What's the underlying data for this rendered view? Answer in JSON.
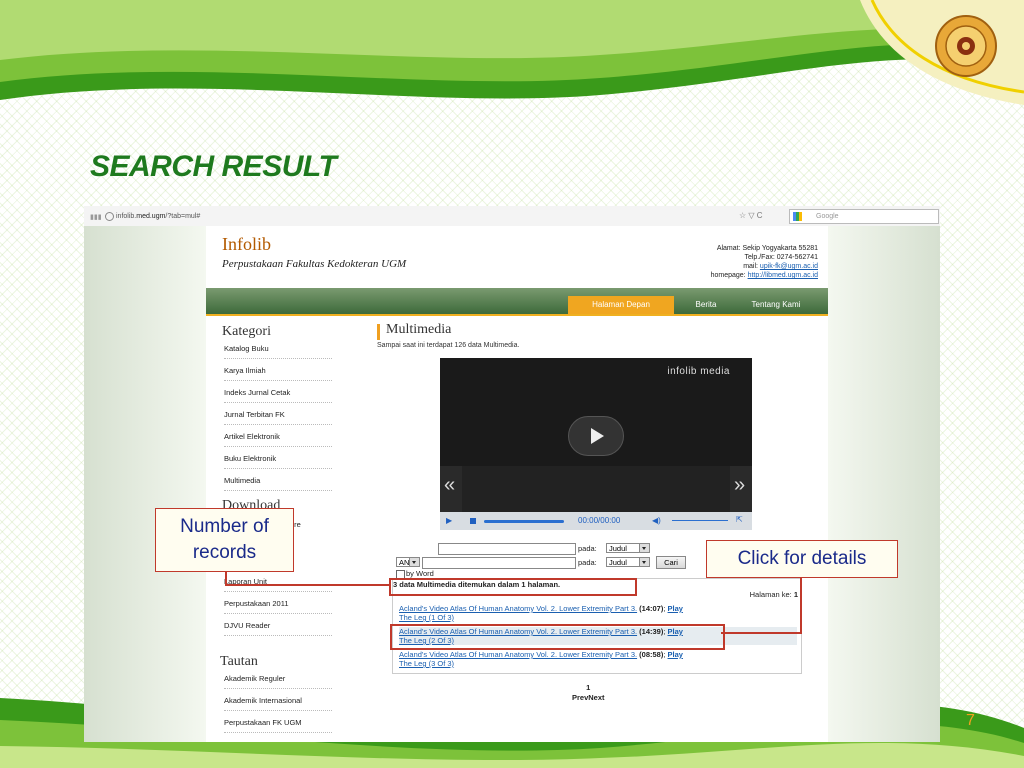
{
  "slide": {
    "title": "SEARCH RESULT",
    "page_number": "7",
    "colors": {
      "accent_green": "#1e7a1e",
      "page_number": "#f0a020",
      "callout_red": "#c0392b",
      "callout_text": "#1a2a8a"
    }
  },
  "browser": {
    "url_prefix": "infolib.",
    "url_domain": "med.ugm",
    "url_suffix": "/?tab=mul#",
    "controls": "☆ ▽ C",
    "search_placeholder": "Google"
  },
  "site": {
    "title": "Infolib",
    "subtitle": "Perpustakaan Fakultas Kedokteran UGM",
    "address": "Alamat: Sekip Yogyakarta 55281",
    "phone": "Telp./Fax: 0274-562741",
    "mail_label": "mail: ",
    "mail": "upik-fk@ugm.ac.id",
    "homepage_label": "homepage: ",
    "homepage": "http://libmed.ugm.ac.id",
    "nav": [
      "Halaman Depan",
      "Berita",
      "Tentang Kami"
    ]
  },
  "sidebar": {
    "kategori_title": "Kategori",
    "kategori": [
      "Katalog Buku",
      "Karya Ilmiah",
      "Indeks Jurnal Cetak",
      "Jurnal Terbitan FK",
      "Artikel Elektronik",
      "Buku Elektronik",
      "Multimedia"
    ],
    "download_title": "Download",
    "download_partial": "ure",
    "download": [
      "Laporan Unit",
      "Perpustakaan 2011",
      "DJVU Reader"
    ],
    "tautan_title": "Tautan",
    "tautan": [
      "Akademik Reguler",
      "Akademik Internasional",
      "Perpustakaan FK UGM"
    ]
  },
  "main": {
    "section_title": "Multimedia",
    "section_sub": "Sampai saat ini terdapat 126 data Multimedia.",
    "player": {
      "brand": "infolib media",
      "time": "00:00/00:00",
      "prev": "«",
      "next": "»"
    },
    "search": {
      "pada": "pada:",
      "field1": "Judul",
      "field2": "Judul",
      "operator": "AND",
      "button": "Cari",
      "by_word": "by Word"
    },
    "result_count": "3 data Multimedia ditemukan dalam 1 halaman.",
    "halaman_label": "Halaman ke: ",
    "halaman_value": "1",
    "results": [
      {
        "title": "Acland's Video Atlas Of Human Anatomy Vol. 2. Lower Extremity Part 3.",
        "duration": "(14:07)",
        "play": "Play",
        "sub": "The Leg (1 Of 3)"
      },
      {
        "title": "Acland's Video Atlas Of Human Anatomy Vol. 2. Lower Extremity Part 3.",
        "duration": "(14:39)",
        "play": "Play",
        "sub": "The Leg (2 Of 3)"
      },
      {
        "title": "Acland's Video Atlas Of Human Anatomy Vol. 2. Lower Extremity Part 3.",
        "duration": "(08:58)",
        "play": "Play",
        "sub": "The Leg (3 Of 3)"
      }
    ],
    "pager_page": "1",
    "pager_links": "PrevNext"
  },
  "callouts": {
    "records_line1": "Number of",
    "records_line2": "records",
    "details": "Click for details"
  }
}
